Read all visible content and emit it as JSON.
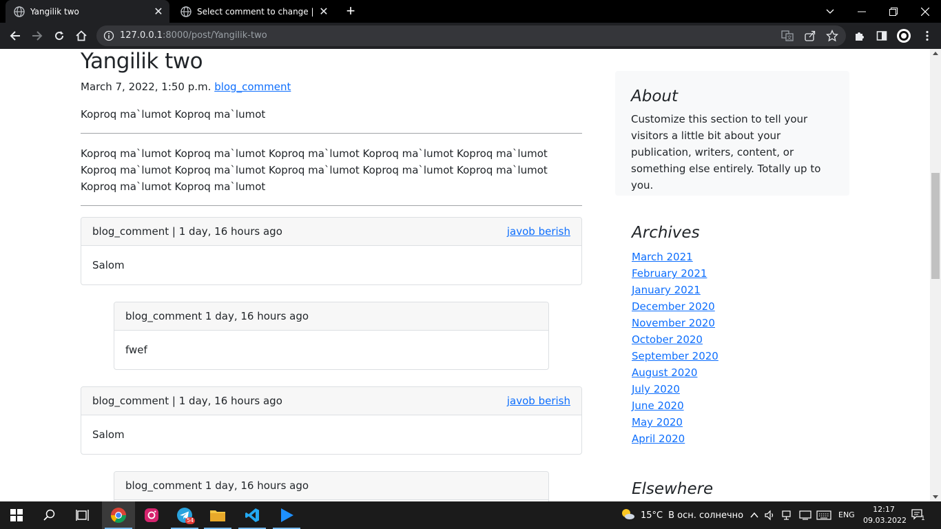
{
  "browser": {
    "tabs": [
      {
        "title": "Yangilik two",
        "active": true
      },
      {
        "title": "Select comment to change | Djan",
        "active": false
      }
    ],
    "url_host": "127.0.0.1",
    "url_rest": ":8000/post/Yangilik-two"
  },
  "post": {
    "title": "Yangilik two",
    "date": "March 7, 2022, 1:50 p.m.",
    "author_link": "blog_comment",
    "summary": "Koproq ma`lumot Koproq ma`lumot",
    "body": "Koproq ma`lumot Koproq ma`lumot Koproq ma`lumot Koproq ma`lumot Koproq ma`lumot Koproq ma`lumot Koproq ma`lumot Koproq ma`lumot Koproq ma`lumot Koproq ma`lumot Koproq ma`lumot Koproq ma`lumot"
  },
  "comments": [
    {
      "header": "blog_comment | 1 day, 16 hours ago",
      "reply": "javob berish",
      "text": "Salom"
    },
    {
      "header": "blog_comment 1 day, 16 hours ago",
      "text": "fwef"
    },
    {
      "header": "blog_comment | 1 day, 16 hours ago",
      "reply": "javob berish",
      "text": "Salom"
    },
    {
      "header": "blog_comment 1 day, 16 hours ago",
      "text": ""
    }
  ],
  "sidebar": {
    "about_title": "About",
    "about_text": "Customize this section to tell your visitors a little bit about your publication, writers, content, or something else entirely. Totally up to you.",
    "archives_title": "Archives",
    "archives": [
      "March 2021",
      "February 2021",
      "January 2021",
      "December 2020",
      "November 2020",
      "October 2020",
      "September 2020",
      "August 2020",
      "July 2020",
      "June 2020",
      "May 2020",
      "April 2020"
    ],
    "elsewhere_title": "Elsewhere"
  },
  "taskbar": {
    "weather_temp": "15°C",
    "weather_desc": "В осн. солнечно",
    "lang": "ENG",
    "time": "12:17",
    "date": "09.03.2022",
    "telegram_badge": "54",
    "notif_count": "1"
  },
  "colors": {
    "link": "#0d6efd",
    "accent_taskbar": "#76b9ed"
  }
}
